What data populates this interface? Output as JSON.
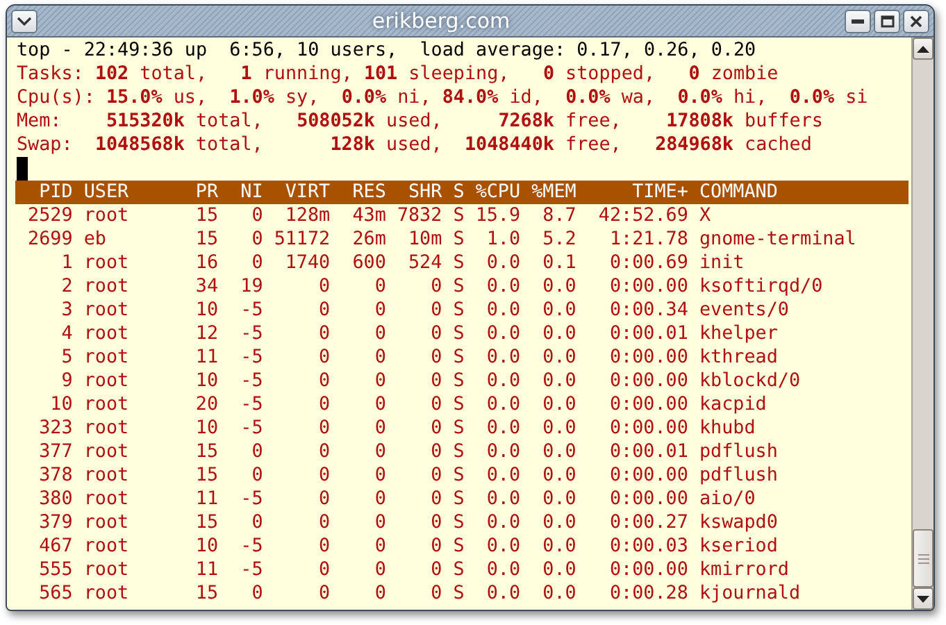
{
  "window": {
    "title": "erikberg.com"
  },
  "summary": [
    {
      "kind": "plain",
      "text": "top - 22:49:36 up  6:56, 10 users,  load average: 0.17, 0.26, 0.20"
    },
    {
      "kind": "stats",
      "text": "Tasks: **102** total,   **1** running, **101** sleeping,   **0** stopped,   **0** zombie"
    },
    {
      "kind": "stats",
      "text": "Cpu(s): **15.0%** us,  **1.0%** sy,  **0.0%** ni, **84.0%** id,  **0.0%** wa,  **0.0%** hi,  **0.0%** si"
    },
    {
      "kind": "stats",
      "text": "Mem:    **515320k** total,   **508052k** used,     **7268k** free,    **17808k** buffers"
    },
    {
      "kind": "stats",
      "text": "Swap:  **1048568k** total,      **128k** used,  **1048440k** free,   **284968k** cached"
    }
  ],
  "table": {
    "columns": [
      "PID",
      "USER",
      "PR",
      "NI",
      "VIRT",
      "RES",
      "SHR",
      "S",
      "%CPU",
      "%MEM",
      "TIME+",
      "COMMAND"
    ],
    "rows": [
      [
        "2529",
        "root",
        "15",
        "0",
        "128m",
        "43m",
        "7832",
        "S",
        "15.9",
        "8.7",
        "42:52.69",
        "X"
      ],
      [
        "2699",
        "eb",
        "15",
        "0",
        "51172",
        "26m",
        "10m",
        "S",
        "1.0",
        "5.2",
        "1:21.78",
        "gnome-terminal"
      ],
      [
        "1",
        "root",
        "16",
        "0",
        "1740",
        "600",
        "524",
        "S",
        "0.0",
        "0.1",
        "0:00.69",
        "init"
      ],
      [
        "2",
        "root",
        "34",
        "19",
        "0",
        "0",
        "0",
        "S",
        "0.0",
        "0.0",
        "0:00.00",
        "ksoftirqd/0"
      ],
      [
        "3",
        "root",
        "10",
        "-5",
        "0",
        "0",
        "0",
        "S",
        "0.0",
        "0.0",
        "0:00.34",
        "events/0"
      ],
      [
        "4",
        "root",
        "12",
        "-5",
        "0",
        "0",
        "0",
        "S",
        "0.0",
        "0.0",
        "0:00.01",
        "khelper"
      ],
      [
        "5",
        "root",
        "11",
        "-5",
        "0",
        "0",
        "0",
        "S",
        "0.0",
        "0.0",
        "0:00.00",
        "kthread"
      ],
      [
        "9",
        "root",
        "10",
        "-5",
        "0",
        "0",
        "0",
        "S",
        "0.0",
        "0.0",
        "0:00.00",
        "kblockd/0"
      ],
      [
        "10",
        "root",
        "20",
        "-5",
        "0",
        "0",
        "0",
        "S",
        "0.0",
        "0.0",
        "0:00.00",
        "kacpid"
      ],
      [
        "323",
        "root",
        "10",
        "-5",
        "0",
        "0",
        "0",
        "S",
        "0.0",
        "0.0",
        "0:00.00",
        "khubd"
      ],
      [
        "377",
        "root",
        "15",
        "0",
        "0",
        "0",
        "0",
        "S",
        "0.0",
        "0.0",
        "0:00.01",
        "pdflush"
      ],
      [
        "378",
        "root",
        "15",
        "0",
        "0",
        "0",
        "0",
        "S",
        "0.0",
        "0.0",
        "0:00.00",
        "pdflush"
      ],
      [
        "380",
        "root",
        "11",
        "-5",
        "0",
        "0",
        "0",
        "S",
        "0.0",
        "0.0",
        "0:00.00",
        "aio/0"
      ],
      [
        "379",
        "root",
        "15",
        "0",
        "0",
        "0",
        "0",
        "S",
        "0.0",
        "0.0",
        "0:00.27",
        "kswapd0"
      ],
      [
        "467",
        "root",
        "10",
        "-5",
        "0",
        "0",
        "0",
        "S",
        "0.0",
        "0.0",
        "0:00.03",
        "kseriod"
      ],
      [
        "555",
        "root",
        "11",
        "-5",
        "0",
        "0",
        "0",
        "S",
        "0.0",
        "0.0",
        "0:00.00",
        "kmirrord"
      ],
      [
        "565",
        "root",
        "15",
        "0",
        "0",
        "0",
        "0",
        "S",
        "0.0",
        "0.0",
        "0:00.28",
        "kjournald"
      ]
    ]
  }
}
